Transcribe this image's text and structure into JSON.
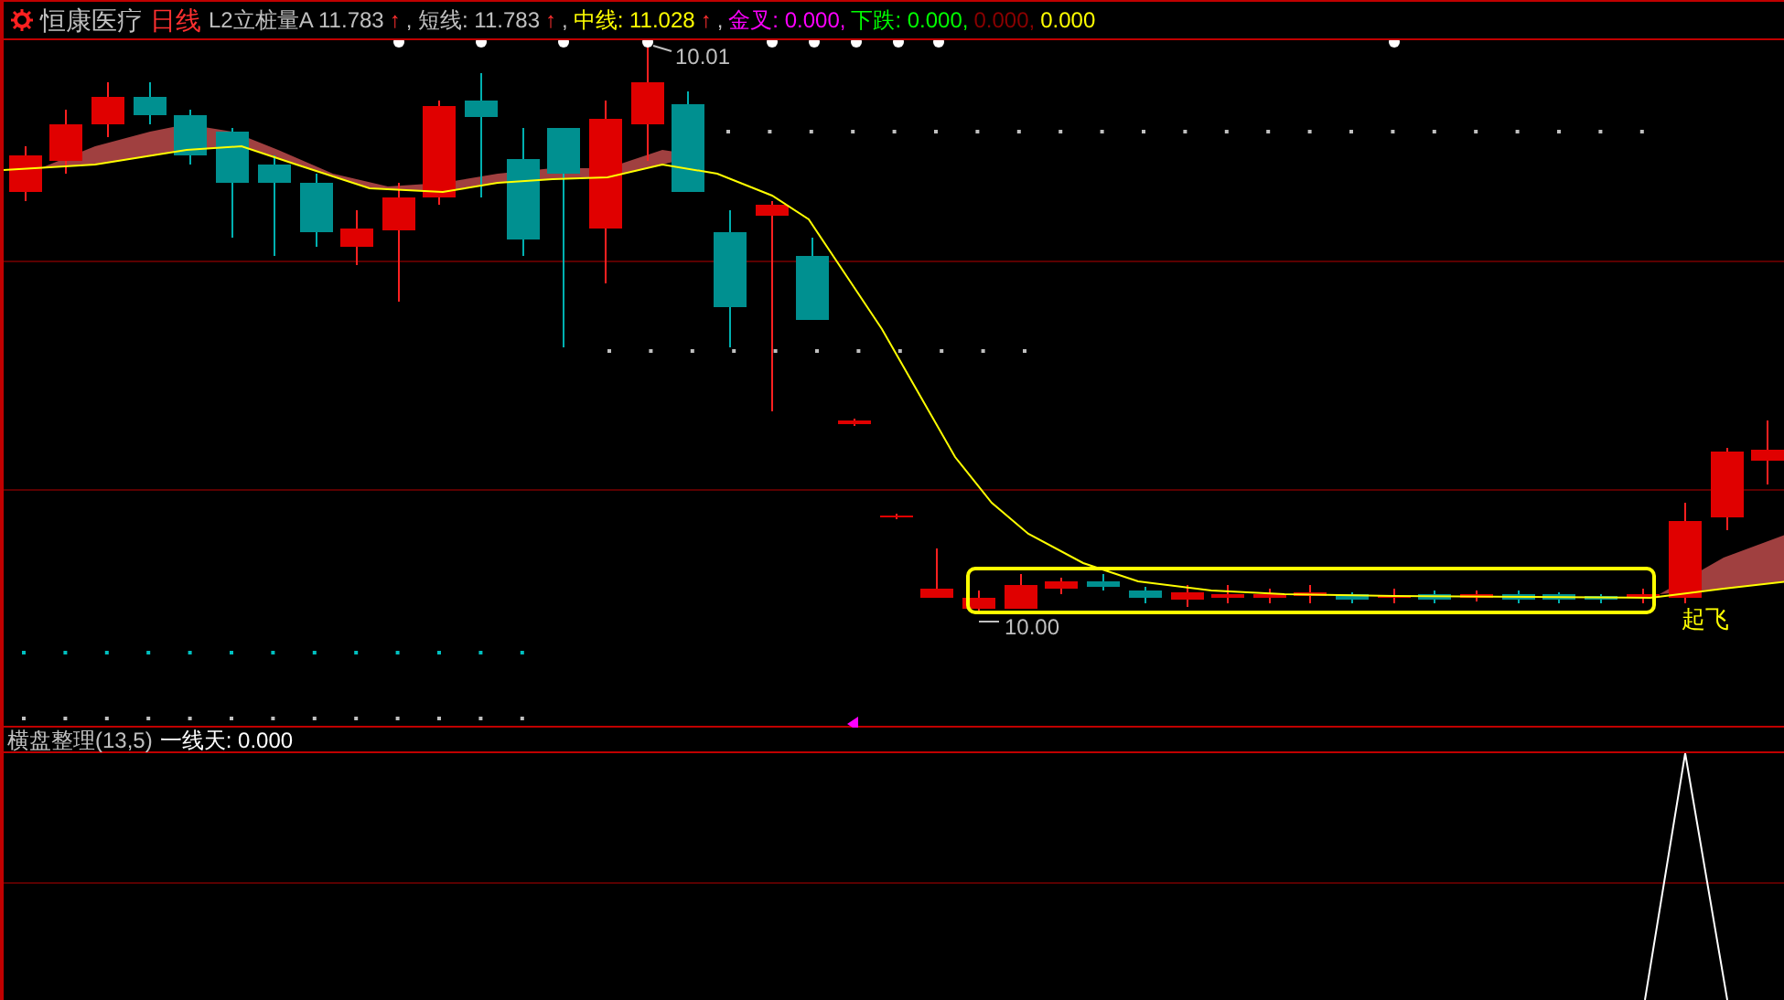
{
  "header": {
    "stock": "恒康医疗",
    "period": "日线",
    "segments": [
      {
        "text": "L2立桩量A 11.783",
        "kind": "plain"
      },
      {
        "text": "↑",
        "kind": "arrow"
      },
      {
        "text": ", 短线: 11.783",
        "kind": "plain"
      },
      {
        "text": "↑",
        "kind": "arrow"
      },
      {
        "text": ",",
        "kind": "plain"
      },
      {
        "text": "中线: 11.028",
        "kind": "mid"
      },
      {
        "text": "↑",
        "kind": "arrow"
      },
      {
        "text": ",",
        "kind": "plain"
      },
      {
        "text": "金叉: 0.000,",
        "kind": "cross"
      },
      {
        "text": "下跌: 0.000,",
        "kind": "fall"
      },
      {
        "text": "0.000,",
        "kind": "dim"
      },
      {
        "text": "0.000",
        "kind": "mid"
      }
    ]
  },
  "main_chart": {
    "high_label": "10.01",
    "low_label": "10.00",
    "signal_label": "起飞"
  },
  "lower_panel": {
    "title": "横盘整理(13,5)",
    "value": "一线天: 0.000"
  }
}
